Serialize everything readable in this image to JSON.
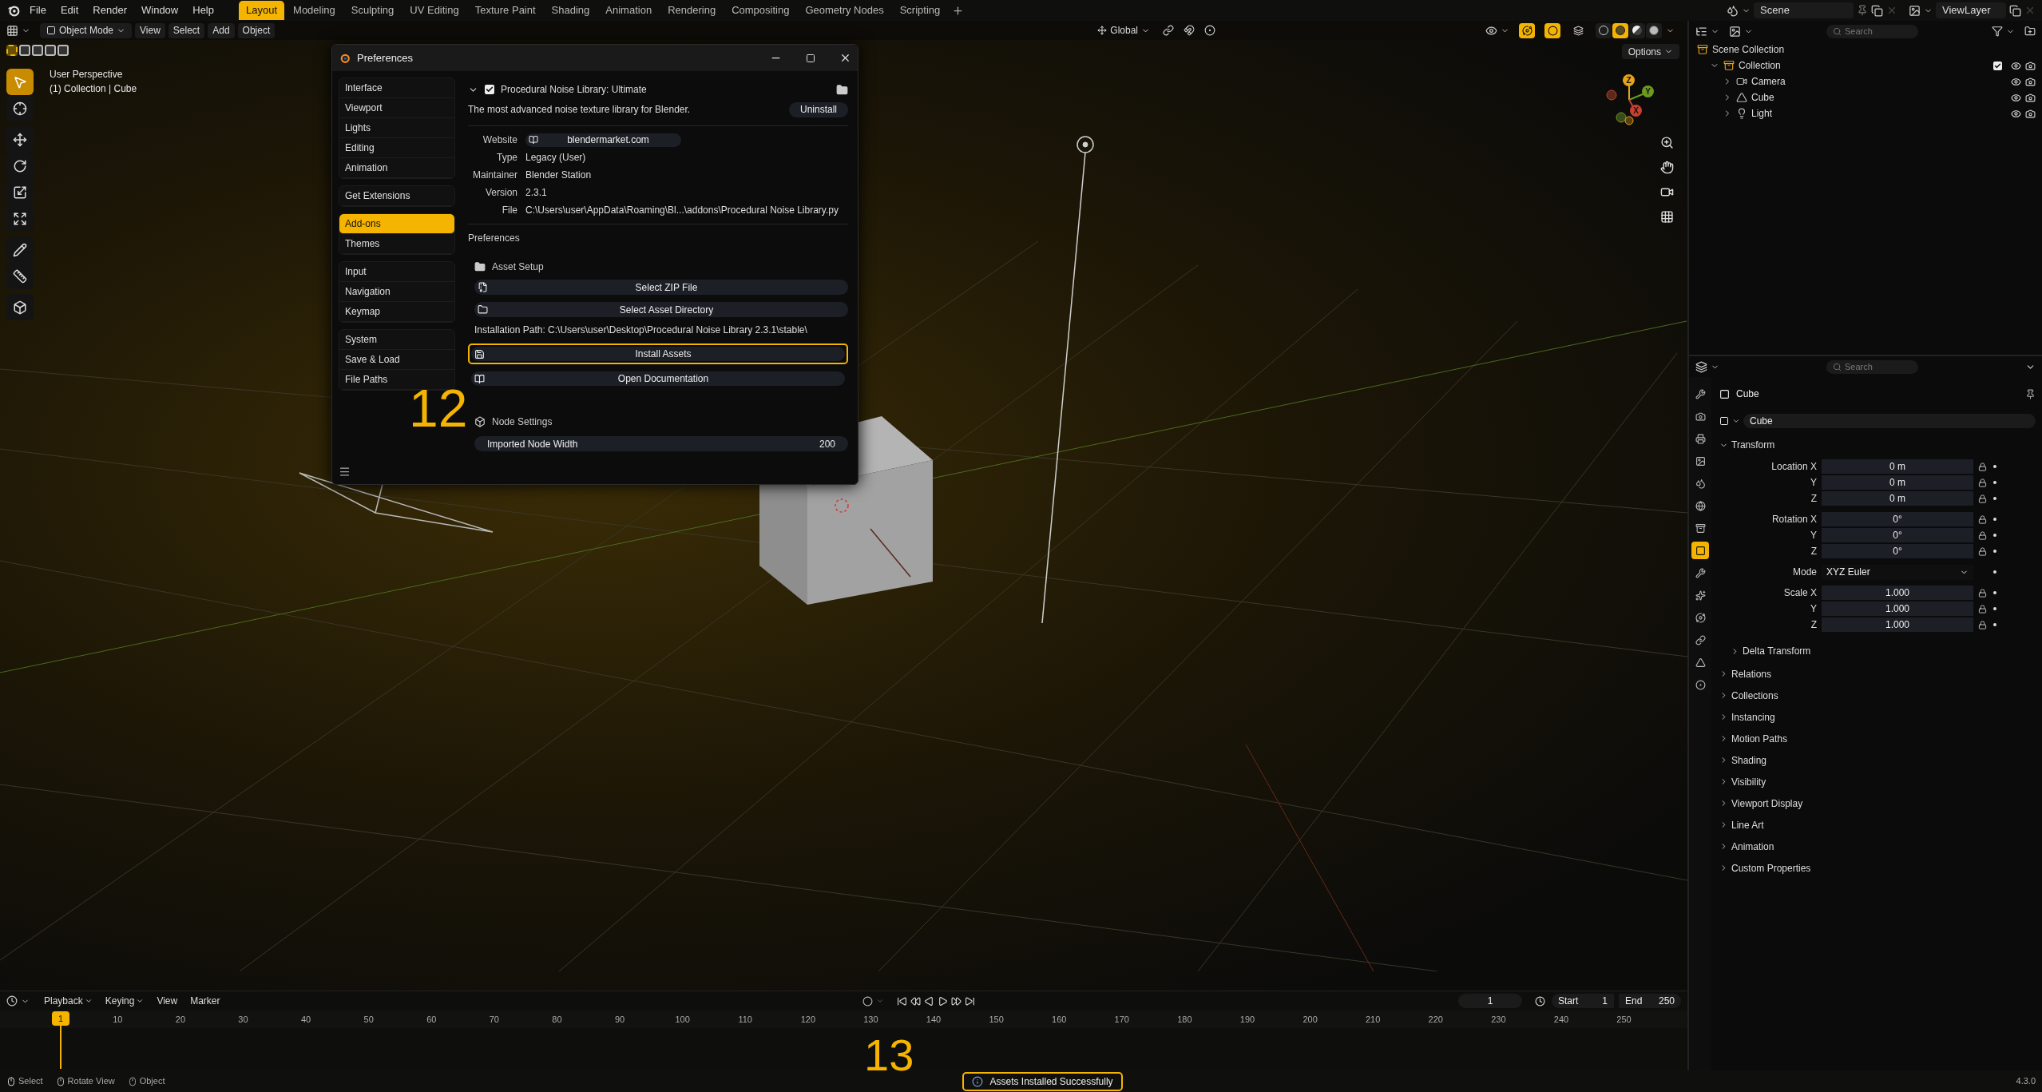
{
  "menu_bar": [
    "File",
    "Edit",
    "Render",
    "Window",
    "Help"
  ],
  "workspaces": [
    {
      "label": "Layout",
      "selected": true
    },
    {
      "label": "Modeling",
      "selected": false
    },
    {
      "label": "Sculpting",
      "selected": false
    },
    {
      "label": "UV Editing",
      "selected": false
    },
    {
      "label": "Texture Paint",
      "selected": false
    },
    {
      "label": "Shading",
      "selected": false
    },
    {
      "label": "Animation",
      "selected": false
    },
    {
      "label": "Rendering",
      "selected": false
    },
    {
      "label": "Compositing",
      "selected": false
    },
    {
      "label": "Geometry Nodes",
      "selected": false
    },
    {
      "label": "Scripting",
      "selected": false
    }
  ],
  "scene": "Scene",
  "view_layer": "ViewLayer",
  "viewport_header": {
    "mode": "Object Mode",
    "menus": [
      "View",
      "Select",
      "Add",
      "Object"
    ],
    "orientation": "Global",
    "toggles": [
      {
        "kind": "gizmo",
        "on": true
      },
      {
        "kind": "overlay",
        "on": true
      },
      {
        "kind": "xray",
        "on": false
      }
    ],
    "shading_modes": [
      {
        "kind": "wireframe",
        "selected": false
      },
      {
        "kind": "solid",
        "selected": true
      },
      {
        "kind": "material",
        "selected": false
      },
      {
        "kind": "rendered",
        "selected": false
      }
    ]
  },
  "viewport": {
    "options": "Options",
    "view_name": "User Perspective",
    "context": "(1) Collection | Cube",
    "select_modes": [
      {
        "selected": true
      },
      {
        "selected": false
      },
      {
        "selected": false
      },
      {
        "selected": false
      },
      {
        "selected": false
      }
    ],
    "tools": [
      {
        "kind": "select",
        "selected": true
      },
      {
        "kind": "cursor",
        "selected": false
      },
      {
        "kind": "move",
        "selected": false
      },
      {
        "kind": "rotate",
        "selected": false
      },
      {
        "kind": "scale",
        "selected": false
      },
      {
        "kind": "transform",
        "selected": false
      },
      {
        "kind": "annotate",
        "selected": false
      },
      {
        "kind": "measure",
        "selected": false
      },
      {
        "kind": "add_cube",
        "selected": false
      }
    ],
    "gizmo": [
      {
        "label": "Z",
        "color": "#e8a317"
      },
      {
        "label": "Y",
        "color": "#6c9a1e"
      },
      {
        "label": "X",
        "color": "#c8402f"
      }
    ]
  },
  "preferences": {
    "title": "Preferences",
    "nav_groups": [
      [
        {
          "label": "Interface",
          "selected": false
        },
        {
          "label": "Viewport",
          "selected": false
        },
        {
          "label": "Lights",
          "selected": false
        },
        {
          "label": "Editing",
          "selected": false
        },
        {
          "label": "Animation",
          "selected": false
        }
      ],
      [
        {
          "label": "Get Extensions",
          "selected": false
        }
      ],
      [
        {
          "label": "Add-ons",
          "selected": true
        },
        {
          "label": "Themes",
          "selected": false
        }
      ],
      [
        {
          "label": "Input",
          "selected": false
        },
        {
          "label": "Navigation",
          "selected": false
        },
        {
          "label": "Keymap",
          "selected": false
        }
      ],
      [
        {
          "label": "System",
          "selected": false
        },
        {
          "label": "Save & Load",
          "selected": false
        },
        {
          "label": "File Paths",
          "selected": false
        }
      ]
    ],
    "addon": {
      "name": "Procedural Noise Library: Ultimate",
      "enabled": true,
      "expanded": true,
      "description": "The most advanced noise texture library for Blender.",
      "uninstall": "Uninstall",
      "details": [
        {
          "label": "Website",
          "value": "blendermarket.com",
          "kind": "link"
        },
        {
          "label": "Type",
          "value": "Legacy (User)",
          "kind": "text"
        },
        {
          "label": "Maintainer",
          "value": "Blender Station",
          "kind": "text"
        },
        {
          "label": "Version",
          "value": "2.3.1",
          "kind": "text"
        },
        {
          "label": "File",
          "value": "C:\\Users\\user\\AppData\\Roaming\\Bl...\\addons\\Procedural Noise Library.py",
          "kind": "text"
        }
      ]
    },
    "section_title": "Preferences",
    "asset_setup": {
      "title": "Asset Setup",
      "buttons": [
        {
          "label": "Select ZIP File",
          "kind": "zip"
        },
        {
          "label": "Select Asset Directory",
          "kind": "folder"
        }
      ],
      "installation_path": "Installation Path: C:\\Users\\user\\Desktop\\Procedural Noise Library 2.3.1\\stable\\",
      "actions": [
        {
          "label": "Install Assets",
          "kind": "save",
          "highlighted": true
        },
        {
          "label": "Open Documentation",
          "kind": "help",
          "highlighted": false
        }
      ]
    },
    "node_settings": {
      "title": "Node Settings",
      "field": {
        "label": "Imported Node Width",
        "value": "200"
      }
    }
  },
  "annotations": [
    "12",
    "13"
  ],
  "outliner": {
    "search_placeholder": "Search",
    "tree": [
      {
        "label": "Scene Collection",
        "kind": "scene_collection",
        "children": [
          {
            "label": "Collection",
            "kind": "collection",
            "expanded": true,
            "checked": true,
            "children": [
              {
                "label": "Camera",
                "kind": "camera",
                "expanded": false
              },
              {
                "label": "Cube",
                "kind": "mesh",
                "expanded": false
              },
              {
                "label": "Light",
                "kind": "light",
                "expanded": false
              }
            ]
          }
        ]
      }
    ]
  },
  "properties": {
    "search_placeholder": "Search",
    "tabs": [
      {
        "kind": "tool",
        "selected": false
      },
      {
        "kind": "render",
        "selected": false
      },
      {
        "kind": "output",
        "selected": false
      },
      {
        "kind": "view_layer",
        "selected": false
      },
      {
        "kind": "scene",
        "selected": false
      },
      {
        "kind": "world",
        "selected": false
      },
      {
        "kind": "collection",
        "selected": false
      },
      {
        "kind": "object",
        "selected": true
      },
      {
        "kind": "modifiers",
        "selected": false
      },
      {
        "kind": "particles",
        "selected": false
      },
      {
        "kind": "physics",
        "selected": false
      },
      {
        "kind": "constraints",
        "selected": false
      },
      {
        "kind": "data",
        "selected": false
      },
      {
        "kind": "material",
        "selected": false
      }
    ],
    "object_name": "Cube",
    "data_name": "Cube",
    "transform": {
      "title": "Transform",
      "expanded": true,
      "groups": [
        {
          "fields": [
            {
              "label": "Location X",
              "value": "0 m"
            },
            {
              "label": "Y",
              "value": "0 m"
            },
            {
              "label": "Z",
              "value": "0 m"
            }
          ]
        },
        {
          "fields": [
            {
              "label": "Rotation X",
              "value": "0°"
            },
            {
              "label": "Y",
              "value": "0°"
            },
            {
              "label": "Z",
              "value": "0°"
            }
          ]
        },
        {
          "fields": [
            {
              "label": "Scale X",
              "value": "1.000"
            },
            {
              "label": "Y",
              "value": "1.000"
            },
            {
              "label": "Z",
              "value": "1.000"
            }
          ]
        }
      ],
      "mode": {
        "label": "Mode",
        "value": "XYZ Euler"
      },
      "delta": "Delta Transform"
    },
    "panels": [
      "Relations",
      "Collections",
      "Instancing",
      "Motion Paths",
      "Shading",
      "Visibility",
      "Viewport Display",
      "Line Art",
      "Animation",
      "Custom Properties"
    ]
  },
  "timeline": {
    "menus": [
      "Playback",
      "Keying",
      "View",
      "Marker"
    ],
    "current_frame": "1",
    "start_label": "Start",
    "start": "1",
    "end_label": "End",
    "end": "250",
    "playhead": "1",
    "ruler": [
      "10",
      "20",
      "30",
      "40",
      "50",
      "60",
      "70",
      "80",
      "90",
      "100",
      "110",
      "120",
      "130",
      "140",
      "150",
      "160",
      "170",
      "180",
      "190",
      "200",
      "210",
      "220",
      "230",
      "240",
      "250"
    ]
  },
  "status_bar": {
    "hints": [
      {
        "kind": "left",
        "label": "Select"
      },
      {
        "kind": "middle",
        "label": "Rotate View"
      },
      {
        "kind": "right",
        "label": "Object"
      }
    ],
    "message": "Assets Installed Successfully",
    "version": "4.3.0"
  }
}
